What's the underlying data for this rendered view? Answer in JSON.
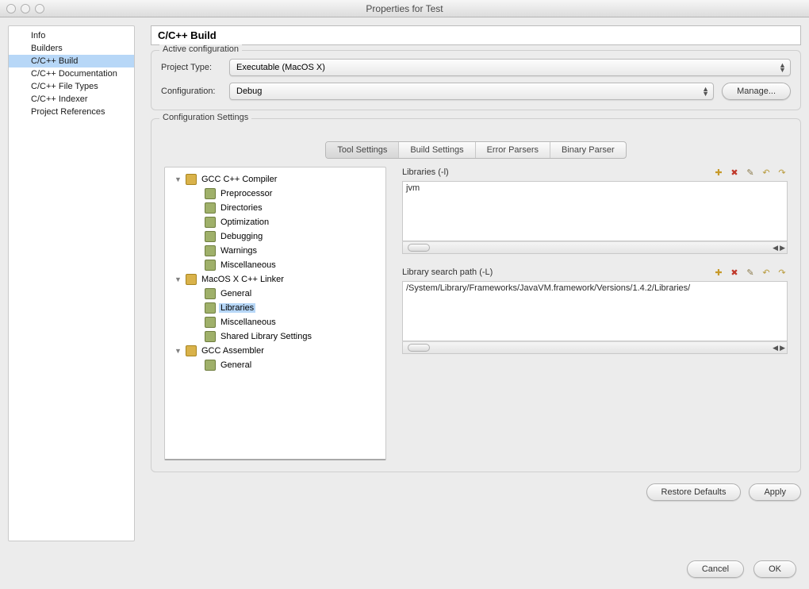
{
  "window": {
    "title": "Properties for Test"
  },
  "nav": {
    "items": [
      {
        "label": "Info",
        "selected": false
      },
      {
        "label": "Builders",
        "selected": false
      },
      {
        "label": "C/C++ Build",
        "selected": true
      },
      {
        "label": "C/C++ Documentation",
        "selected": false
      },
      {
        "label": "C/C++ File Types",
        "selected": false
      },
      {
        "label": "C/C++ Indexer",
        "selected": false
      },
      {
        "label": "Project References",
        "selected": false
      }
    ]
  },
  "page": {
    "title": "C/C++ Build"
  },
  "activeConfig": {
    "group_label": "Active configuration",
    "projectType_label": "Project Type:",
    "projectType_value": "Executable (MacOS X)",
    "configuration_label": "Configuration:",
    "configuration_value": "Debug",
    "manage_label": "Manage..."
  },
  "configSettings": {
    "group_label": "Configuration Settings",
    "tabs": [
      {
        "label": "Tool Settings",
        "active": true
      },
      {
        "label": "Build Settings",
        "active": false
      },
      {
        "label": "Error Parsers",
        "active": false
      },
      {
        "label": "Binary Parser",
        "active": false
      }
    ]
  },
  "tree": [
    {
      "type": "tool",
      "label": "GCC C++ Compiler",
      "expanded": true
    },
    {
      "type": "opt",
      "label": "Preprocessor",
      "child": true
    },
    {
      "type": "opt",
      "label": "Directories",
      "child": true
    },
    {
      "type": "opt",
      "label": "Optimization",
      "child": true
    },
    {
      "type": "opt",
      "label": "Debugging",
      "child": true
    },
    {
      "type": "opt",
      "label": "Warnings",
      "child": true
    },
    {
      "type": "opt",
      "label": "Miscellaneous",
      "child": true
    },
    {
      "type": "tool",
      "label": "MacOS X C++ Linker",
      "expanded": true
    },
    {
      "type": "opt",
      "label": "General",
      "child": true
    },
    {
      "type": "opt",
      "label": "Libraries",
      "child": true,
      "selected": true
    },
    {
      "type": "opt",
      "label": "Miscellaneous",
      "child": true
    },
    {
      "type": "opt",
      "label": "Shared Library Settings",
      "child": true
    },
    {
      "type": "tool",
      "label": "GCC Assembler",
      "expanded": true
    },
    {
      "type": "opt",
      "label": "General",
      "child": true
    }
  ],
  "libraries": {
    "header": "Libraries (-l)",
    "items": [
      "jvm"
    ]
  },
  "libPath": {
    "header": "Library search path (-L)",
    "items": [
      "/System/Library/Frameworks/JavaVM.framework/Versions/1.4.2/Libraries/"
    ]
  },
  "toolIcons": {
    "add": "add-icon",
    "delete": "delete-icon",
    "edit": "edit-icon",
    "up": "move-up-icon",
    "down": "move-down-icon"
  },
  "buttons": {
    "restore": "Restore Defaults",
    "apply": "Apply",
    "cancel": "Cancel",
    "ok": "OK"
  }
}
